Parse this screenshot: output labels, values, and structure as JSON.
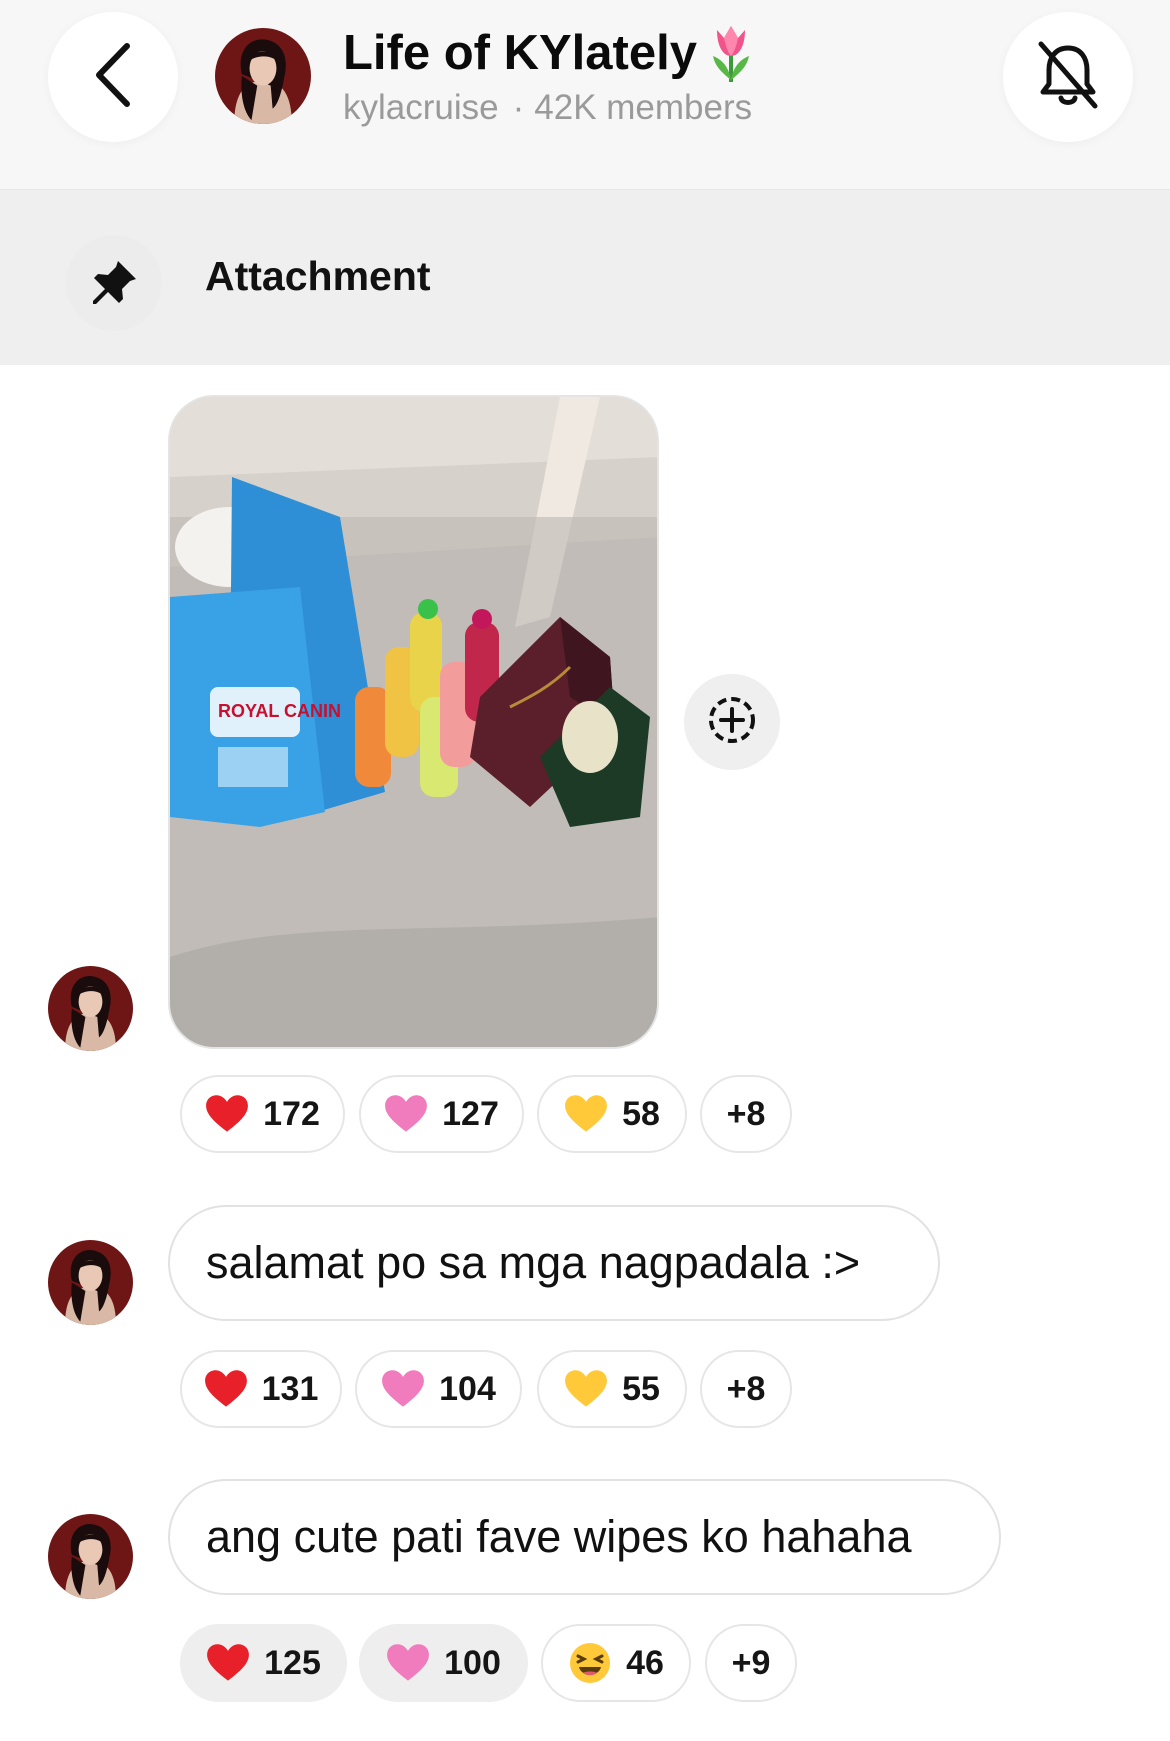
{
  "header": {
    "title": "Life of KYlately",
    "username": "kylacruise",
    "separator": "·",
    "members": "42K members"
  },
  "pinned": {
    "label": "Attachment"
  },
  "messages": [
    {
      "type": "image",
      "reactions": [
        {
          "emoji": "red-heart",
          "count": "172"
        },
        {
          "emoji": "pink-heart",
          "count": "127"
        },
        {
          "emoji": "yellow-heart",
          "count": "58"
        },
        {
          "more": "+8"
        }
      ]
    },
    {
      "type": "text",
      "text": "salamat po sa mga nagpadala :>",
      "reactions": [
        {
          "emoji": "red-heart",
          "count": "131"
        },
        {
          "emoji": "pink-heart",
          "count": "104"
        },
        {
          "emoji": "yellow-heart",
          "count": "55"
        },
        {
          "more": "+8"
        }
      ]
    },
    {
      "type": "text",
      "text": "ang cute pati fave wipes ko hahaha",
      "reactions": [
        {
          "emoji": "red-heart",
          "count": "125"
        },
        {
          "emoji": "pink-heart",
          "count": "100"
        },
        {
          "emoji": "laughing-face",
          "count": "46"
        },
        {
          "more": "+9"
        }
      ]
    }
  ],
  "colors": {
    "header_bg": "#f7f7f7",
    "pinned_bg": "#efefef",
    "subtitle_gray": "#9a9a9a",
    "red_heart": "#e8202a",
    "pink_heart": "#f07bbd",
    "yellow_heart": "#ffc93a"
  }
}
